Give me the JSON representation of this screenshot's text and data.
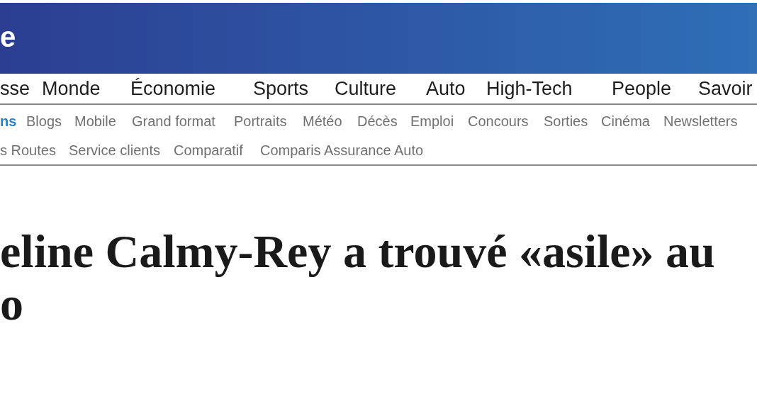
{
  "header": {
    "logo": "e"
  },
  "main_nav": [
    {
      "label": "sse"
    },
    {
      "label": "Monde"
    },
    {
      "label": "Économie"
    },
    {
      "label": "Sports"
    },
    {
      "label": "Culture"
    },
    {
      "label": "Auto"
    },
    {
      "label": "High-Tech"
    },
    {
      "label": "People"
    },
    {
      "label": "Savoir"
    }
  ],
  "sub_nav": [
    {
      "label": "ns",
      "selected": true
    },
    {
      "label": "Blogs",
      "selected": false
    },
    {
      "label": "Mobile",
      "selected": false
    },
    {
      "label": "Grand format",
      "selected": false
    },
    {
      "label": "Portraits",
      "selected": false
    },
    {
      "label": "Météo",
      "selected": false
    },
    {
      "label": "Décès",
      "selected": false
    },
    {
      "label": "Emploi",
      "selected": false
    },
    {
      "label": "Concours",
      "selected": false
    },
    {
      "label": "Sorties",
      "selected": false
    },
    {
      "label": "Cinéma",
      "selected": false
    },
    {
      "label": "Newsletters",
      "selected": false
    }
  ],
  "sub_nav_2": [
    {
      "label": "s Routes"
    },
    {
      "label": "Service clients"
    },
    {
      "label": "Comparatif"
    },
    {
      "label": "Comparis Assurance Auto"
    }
  ],
  "article": {
    "headline": [
      "eline Calmy-Rey a trouvé «asile» au",
      "o"
    ]
  }
}
